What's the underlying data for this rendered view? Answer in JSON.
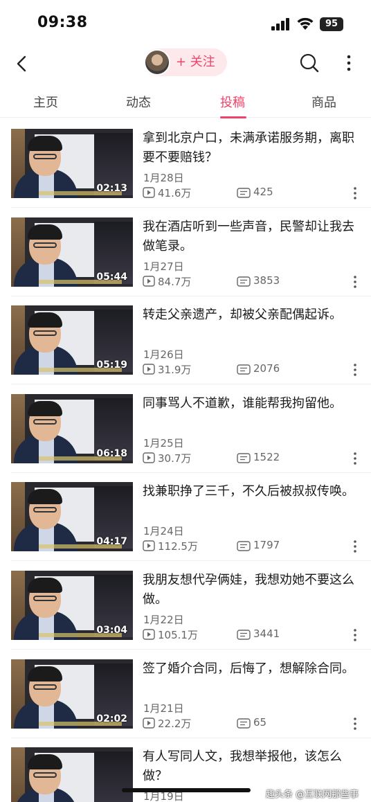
{
  "status_bar": {
    "time": "09:38",
    "battery": "95"
  },
  "nav": {
    "follow_label": "+ 关注"
  },
  "tabs": [
    {
      "label": "主页"
    },
    {
      "label": "动态"
    },
    {
      "label": "投稿",
      "active": true
    },
    {
      "label": "商品"
    }
  ],
  "videos": [
    {
      "title": "拿到北京户口，未满承诺服务期，离职要不要赔钱？",
      "date": "1月28日",
      "views": "41.6万",
      "comments": "425",
      "duration": "02:13"
    },
    {
      "title": "我在酒店听到一些声音，民警却让我去做笔录。",
      "date": "1月27日",
      "views": "84.7万",
      "comments": "3853",
      "duration": "05:44"
    },
    {
      "title": "转走父亲遗产，却被父亲配偶起诉。",
      "date": "1月26日",
      "views": "31.9万",
      "comments": "2076",
      "duration": "05:19"
    },
    {
      "title": "同事骂人不道歉，谁能帮我拘留他。",
      "date": "1月25日",
      "views": "30.7万",
      "comments": "1522",
      "duration": "06:18"
    },
    {
      "title": "找兼职挣了三千，不久后被叔叔传唤。",
      "date": "1月24日",
      "views": "112.5万",
      "comments": "1797",
      "duration": "04:17"
    },
    {
      "title": "我朋友想代孕俩娃，我想劝她不要这么做。",
      "date": "1月22日",
      "views": "105.1万",
      "comments": "3441",
      "duration": "03:04"
    },
    {
      "title": "签了婚介合同，后悔了，想解除合同。",
      "date": "1月21日",
      "views": "22.2万",
      "comments": "65",
      "duration": "02:02"
    },
    {
      "title": "有人写同人文，我想举报他，该怎么做？",
      "date": "1月19日",
      "views": "",
      "comments": "",
      "duration": ""
    }
  ],
  "watermark": "趣头条 @互联网那些事",
  "colors": {
    "accent": "#f0436a",
    "follow_bg": "#fde8ec"
  },
  "icons": [
    "back-icon",
    "search-icon",
    "more-icon",
    "play-icon",
    "comment-icon",
    "signal-icon",
    "wifi-icon"
  ]
}
